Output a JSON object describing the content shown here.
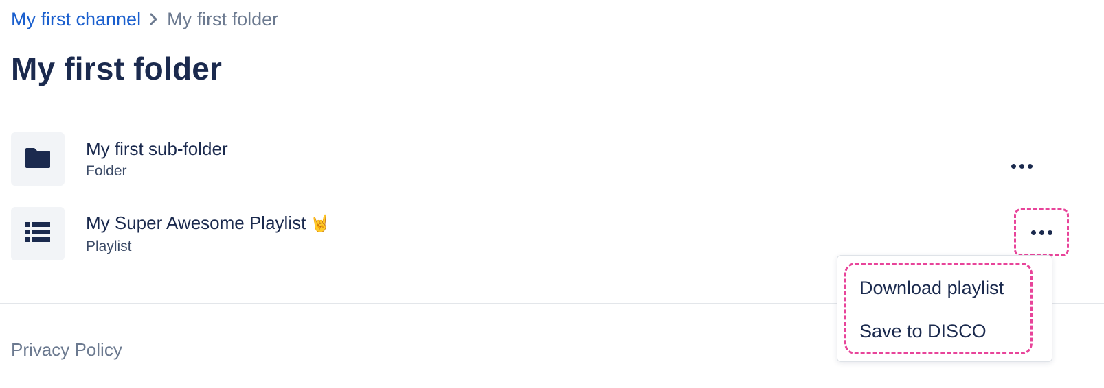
{
  "breadcrumb": {
    "channel": "My first channel",
    "current": "My first folder"
  },
  "title": "My first folder",
  "items": [
    {
      "title": "My first sub-folder",
      "subtitle": "Folder",
      "icon": "folder-icon"
    },
    {
      "title": "My Super Awesome Playlist",
      "emoji": "🤘",
      "subtitle": "Playlist",
      "icon": "list-icon"
    }
  ],
  "menu": {
    "download": "Download playlist",
    "save": "Save to DISCO"
  },
  "footer": {
    "privacy": "Privacy Policy"
  },
  "colors": {
    "link": "#1a5fce",
    "text": "#1b2a4e",
    "muted": "#6c7a90",
    "highlight": "#e8449a"
  }
}
